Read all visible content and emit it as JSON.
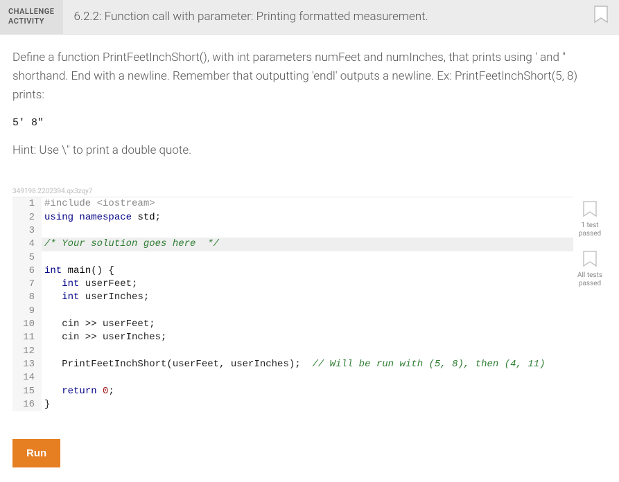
{
  "header": {
    "badge_line1": "CHALLENGE",
    "badge_line2": "ACTIVITY",
    "title": "6.2.2: Function call with parameter: Printing formatted measurement."
  },
  "prompt": "Define a function PrintFeetInchShort(), with int parameters numFeet and numInches, that prints using ' and \" shorthand. End with a newline. Remember that outputting 'endl' outputs a newline. Ex: PrintFeetInchShort(5, 8) prints:",
  "example_output": "5' 8\"",
  "hint": "Hint: Use \\\" to print a double quote.",
  "watermark": "349198.2202394.qx3zqy7",
  "code": {
    "lines": [
      {
        "n": "1"
      },
      {
        "n": "2"
      },
      {
        "n": "3"
      },
      {
        "n": "4"
      },
      {
        "n": "5"
      },
      {
        "n": "6"
      },
      {
        "n": "7"
      },
      {
        "n": "8"
      },
      {
        "n": "9"
      },
      {
        "n": "10"
      },
      {
        "n": "11"
      },
      {
        "n": "12"
      },
      {
        "n": "13"
      },
      {
        "n": "14"
      },
      {
        "n": "15"
      },
      {
        "n": "16"
      }
    ],
    "l1_pp": "#include ",
    "l1_hdr": "<iostream>",
    "l2_a": "using ",
    "l2_b": "namespace ",
    "l2_c": "std",
    "l2_d": ";",
    "l4_cm": "/* Your solution goes here  */",
    "l6_a": "int ",
    "l6_b": "main",
    "l6_c": "() {",
    "l7": "   int userFeet;",
    "l7_a": "   ",
    "l7_b": "int ",
    "l7_c": "userFeet",
    "l7_d": ";",
    "l8_a": "   ",
    "l8_b": "int ",
    "l8_c": "userInches",
    "l8_d": ";",
    "l10": "   cin >> userFeet;",
    "l11": "   cin >> userInches;",
    "l13_a": "   PrintFeetInchShort(userFeet, userInches);  ",
    "l13_b": "// Will be run with (5, 8), then (4, 11)",
    "l15_a": "   ",
    "l15_b": "return ",
    "l15_c": "0",
    "l15_d": ";",
    "l16": "}"
  },
  "side": {
    "badge1_l1": "1 test",
    "badge1_l2": "passed",
    "badge2_l1": "All tests",
    "badge2_l2": "passed"
  },
  "run_label": "Run"
}
